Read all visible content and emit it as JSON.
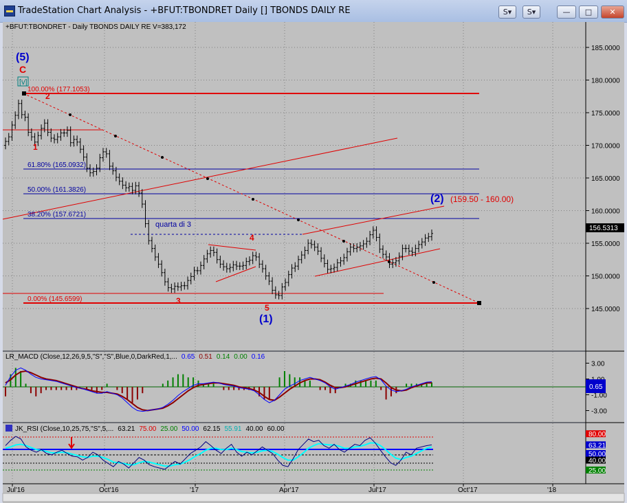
{
  "window": {
    "title": "TradeStation Chart Analysis - +BFUT:TBONDRET Daily [] TBONDS DAILY RE",
    "buttons": {
      "s1": "S",
      "s2": "S"
    }
  },
  "price_header": "+BFUT:TBONDRET - Daily  TBONDS DAILY RE  V=383,172",
  "macd_header": {
    "name": "LR_MACD (Close,12,26,9,5,\"S\",\"S\",Blue,0,DarkRed,1,...",
    "v1": "0.65",
    "v2": "0.51",
    "v3": "0.14",
    "v4": "0.00",
    "v5": "0.16"
  },
  "rsi_header": {
    "name": "JK_RSI (Close,10,25,75,\"S\",5,...",
    "v1": "63.21",
    "v2": "75.00",
    "v3": "25.00",
    "v4": "50.00",
    "v5": "62.15",
    "v6": "55.91",
    "v7": "40.00",
    "v8": "60.00"
  },
  "annotations": {
    "wave5_top": "(5)",
    "c_label": "C",
    "v_label": "[v]",
    "fib100": "100.00% (177.1053)",
    "fib618": "61.80% (165.0932)",
    "fib50": "50.00% (161.3826)",
    "fib382": "38.20% (157.6721)",
    "fib0": "0.00% (145.6599)",
    "quarta": "quarta di 3",
    "lbl1": "1",
    "lbl2": "2",
    "lbl3": "3",
    "lbl4": "4",
    "lbl5": "5",
    "wave1": "(1)",
    "wave2": "(2)",
    "target": "(159.50 - 160.00)"
  },
  "axes": {
    "price_ticks": [
      "185.0000",
      "180.0000",
      "175.0000",
      "170.0000",
      "165.0000",
      "160.0000",
      "155.0000",
      "150.0000",
      "145.0000"
    ],
    "last_price": "156.5313",
    "macd_ticks": [
      "3.00",
      "1.00",
      "-1.00",
      "-3.00"
    ],
    "macd_badge": "0.65",
    "rsi_ticks": [
      "80.00",
      "63.21",
      "50.00",
      "40.00",
      "25.00"
    ],
    "x_ticks": [
      "Jul'16",
      "Oct'16",
      "'17",
      "Apr'17",
      "Jul'17",
      "Oct'17",
      "'18"
    ]
  },
  "colors": {
    "bg": "#c0c0c0",
    "pricebar": "#000000",
    "fib_red": "#e00000",
    "fib_blue": "#0000a0",
    "wave_blue": "#0000cc",
    "macd_red": "#8b0000",
    "macd_blue": "#0000ff",
    "rsi_cyan": "#00ffff"
  },
  "chart_data": {
    "type": "candlestick",
    "symbol": "+BFUT:TBONDRET",
    "ylim": [
      143,
      188
    ],
    "closes": [
      170.6,
      171.3,
      173.1,
      174.6,
      176.4,
      174.7,
      174.3,
      172.0,
      171.3,
      170.5,
      171.5,
      172.6,
      173.4,
      172.0,
      171.1,
      170.9,
      171.3,
      171.9,
      171.9,
      172.3,
      170.4,
      170.9,
      170.5,
      169.4,
      168.2,
      166.5,
      165.8,
      166.0,
      166.5,
      168.1,
      169.0,
      168.7,
      166.8,
      166.1,
      165.1,
      164.5,
      163.9,
      163.5,
      163.7,
      163.1,
      163.8,
      162.7,
      161.0,
      158.0,
      155.4,
      154.2,
      152.9,
      151.8,
      150.5,
      149.1,
      148.2,
      148.0,
      148.4,
      148.3,
      148.5,
      148.5,
      149.3,
      149.9,
      150.8,
      150.8,
      151.6,
      152.6,
      153.4,
      153.9,
      153.6,
      152.5,
      151.8,
      151.4,
      151.1,
      151.3,
      151.7,
      151.5,
      151.5,
      151.6,
      152.2,
      152.4,
      153.1,
      152.9,
      151.8,
      151.1,
      150.0,
      149.2,
      147.8,
      147.1,
      147.0,
      148.3,
      149.0,
      150.2,
      151.2,
      151.5,
      152.5,
      153.2,
      153.9,
      155.0,
      154.8,
      154.4,
      153.8,
      152.7,
      151.9,
      151.0,
      151.1,
      151.3,
      152.0,
      152.3,
      152.8,
      153.7,
      154.4,
      154.2,
      154.4,
      154.6,
      154.9,
      155.3,
      156.3,
      157.0,
      155.9,
      154.1,
      153.3,
      152.9,
      151.8,
      152.0,
      152.3,
      153.0,
      154.2,
      154.2,
      153.8,
      153.6,
      154.2,
      154.8,
      155.2,
      155.8,
      156.0,
      156.5
    ],
    "fib_levels": [
      {
        "pct": "100.00%",
        "price": 177.1053
      },
      {
        "pct": "61.80%",
        "price": 165.0932
      },
      {
        "pct": "50.00%",
        "price": 161.3826
      },
      {
        "pct": "38.20%",
        "price": 157.6721
      },
      {
        "pct": "0.00%",
        "price": 145.6599
      }
    ],
    "macd": {
      "ylim": [
        -4,
        4
      ],
      "macd": [
        0.2,
        1.3,
        2.1,
        2.4,
        2.1,
        1.6,
        1.2,
        1.0,
        0.9,
        0.8,
        0.7,
        0.5,
        0.3,
        0.1,
        -0.1,
        -0.2,
        -0.4,
        -0.6,
        -0.8,
        -0.8,
        -0.6,
        -0.8,
        -1.0,
        -1.4,
        -2.0,
        -2.6,
        -3.0,
        -3.1,
        -3.0,
        -2.9,
        -2.8,
        -2.6,
        -2.2,
        -1.7,
        -1.1,
        -0.6,
        -0.2,
        0.2,
        0.4,
        0.4,
        0.5,
        0.6,
        0.5,
        0.3,
        0.2,
        0.1,
        -0.1,
        -0.2,
        -0.3,
        -0.5,
        -1.0,
        -1.6,
        -2.0,
        -1.7,
        -1.0,
        -0.3,
        0.1,
        0.4,
        0.8,
        1.0,
        1.2,
        1.0,
        0.8,
        0.5,
        0.0,
        -0.3,
        -0.1,
        0.1,
        0.3,
        0.6,
        0.8,
        1.0,
        1.2,
        1.3,
        0.9,
        0.1,
        -0.4,
        -0.6,
        -0.5,
        -0.3,
        0.0,
        0.2,
        0.4,
        0.6,
        0.65
      ],
      "signal": [
        0.5,
        0.9,
        1.5,
        1.9,
        2.0,
        1.8,
        1.5,
        1.2,
        1.0,
        0.9,
        0.8,
        0.6,
        0.4,
        0.2,
        0.0,
        -0.2,
        -0.3,
        -0.5,
        -0.6,
        -0.7,
        -0.7,
        -0.8,
        -0.9,
        -1.2,
        -1.6,
        -2.1,
        -2.6,
        -2.9,
        -3.0,
        -2.9,
        -2.8,
        -2.7,
        -2.4,
        -2.0,
        -1.5,
        -1.0,
        -0.5,
        -0.1,
        0.2,
        0.3,
        0.4,
        0.5,
        0.5,
        0.4,
        0.3,
        0.2,
        0.0,
        -0.1,
        -0.2,
        -0.4,
        -0.7,
        -1.2,
        -1.6,
        -1.7,
        -1.3,
        -0.8,
        -0.3,
        0.1,
        0.5,
        0.8,
        1.0,
        1.0,
        0.9,
        0.6,
        0.2,
        -0.1,
        -0.1,
        0.0,
        0.2,
        0.4,
        0.6,
        0.8,
        1.0,
        1.1,
        1.0,
        0.5,
        -0.1,
        -0.4,
        -0.5,
        -0.4,
        -0.1,
        0.1,
        0.3,
        0.5,
        0.51
      ]
    },
    "rsi": {
      "ylim": [
        20,
        82
      ],
      "rsi": [
        62,
        70,
        76,
        72,
        60,
        55,
        52,
        56,
        50,
        48,
        52,
        55,
        50,
        46,
        45,
        40,
        44,
        52,
        48,
        40,
        35,
        30,
        38,
        34,
        28,
        36,
        44,
        40,
        33,
        30,
        28,
        26,
        32,
        38,
        34,
        42,
        50,
        55,
        60,
        68,
        62,
        55,
        50,
        58,
        64,
        52,
        46,
        52,
        48,
        54,
        60,
        55,
        50,
        40,
        32,
        30,
        42,
        56,
        64,
        72,
        68,
        70,
        62,
        58,
        64,
        56,
        52,
        58,
        64,
        62,
        70,
        74,
        66,
        55,
        45,
        36,
        32,
        40,
        52,
        48,
        58,
        60,
        62,
        63.21
      ],
      "avg": [
        58,
        60,
        63,
        64,
        62,
        59,
        56,
        55,
        53,
        51,
        51,
        52,
        51,
        49,
        47,
        45,
        44,
        46,
        46,
        44,
        41,
        37,
        36,
        35,
        33,
        33,
        36,
        38,
        37,
        35,
        33,
        31,
        31,
        33,
        34,
        37,
        41,
        46,
        50,
        55,
        58,
        58,
        56,
        56,
        58,
        56,
        53,
        52,
        51,
        52,
        54,
        55,
        53,
        49,
        44,
        40,
        40,
        45,
        51,
        58,
        62,
        65,
        64,
        63,
        63,
        61,
        58,
        58,
        60,
        61,
        63,
        66,
        66,
        62,
        56,
        49,
        43,
        41,
        44,
        46,
        50,
        54,
        58,
        60
      ]
    }
  }
}
